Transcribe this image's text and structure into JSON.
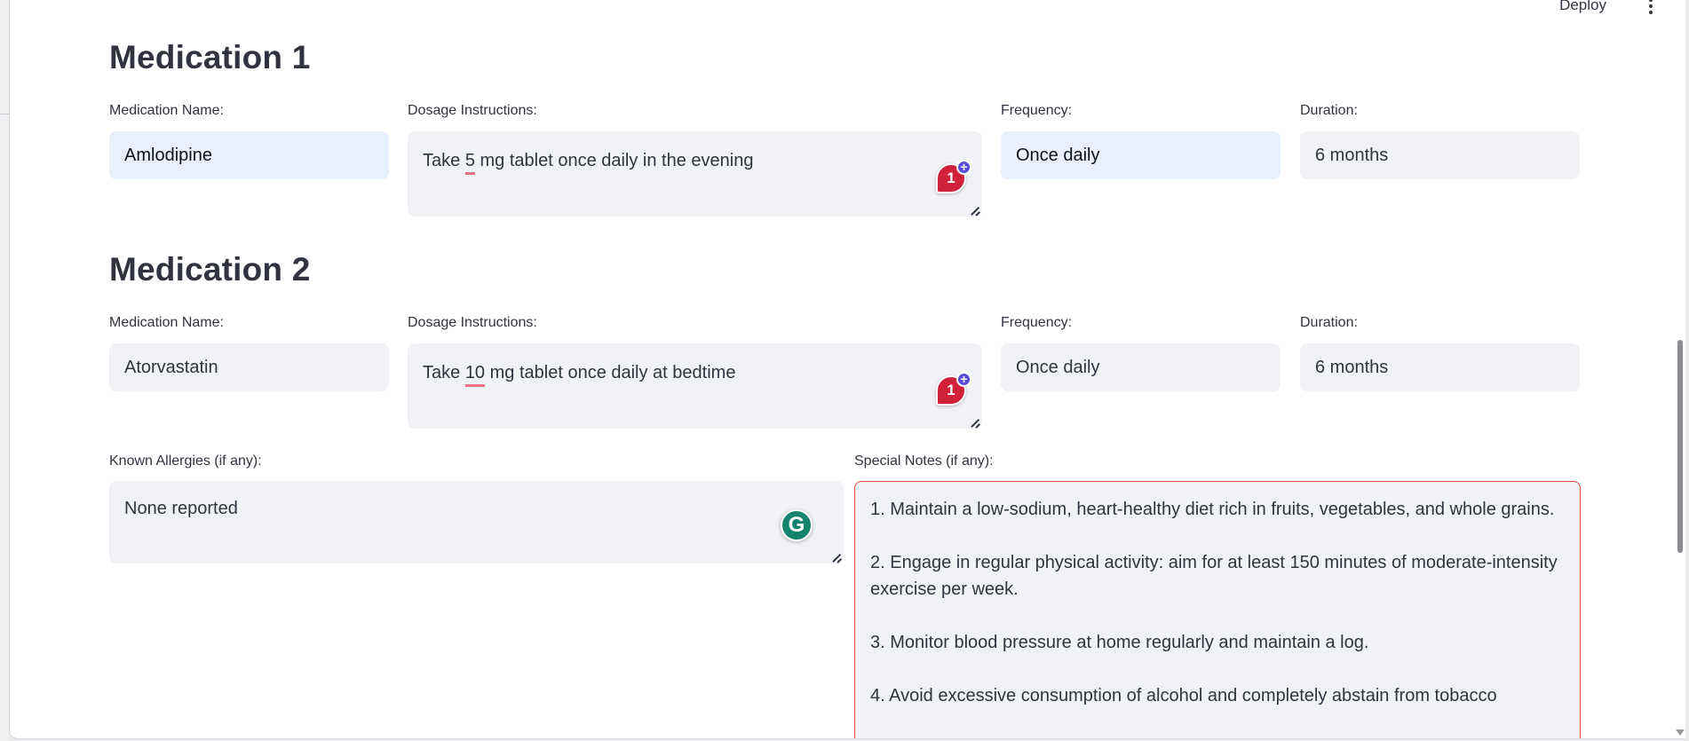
{
  "header": {
    "deploy_label": "Deploy",
    "menu_icon": "kebab-menu-icon"
  },
  "medications": [
    {
      "title": "Medication 1",
      "name_label": "Medication Name:",
      "name_value": "Amlodipine",
      "dosage_label": "Dosage Instructions:",
      "dosage_pre": "Take ",
      "dosage_underlined": "5",
      "dosage_post": " mg tablet once daily in the evening",
      "frequency_label": "Frequency:",
      "frequency_value": "Once daily",
      "duration_label": "Duration:",
      "duration_value": "6 months",
      "badge_count": "1"
    },
    {
      "title": "Medication 2",
      "name_label": "Medication Name:",
      "name_value": "Atorvastatin",
      "dosage_label": "Dosage Instructions:",
      "dosage_pre": "Take ",
      "dosage_underlined": "10",
      "dosage_post": " mg tablet once daily at bedtime",
      "frequency_label": "Frequency:",
      "frequency_value": "Once daily",
      "duration_label": "Duration:",
      "duration_value": "6 months",
      "badge_count": "1"
    }
  ],
  "allergies": {
    "label": "Known Allergies (if any):",
    "value": "None reported",
    "grammarly_glyph": "G"
  },
  "notes": {
    "label": "Special Notes (if any):",
    "items": [
      "1. Maintain a low-sodium, heart-healthy diet rich in fruits, vegetables, and whole grains.",
      "2. Engage in regular physical activity: aim for at least 150 minutes of moderate-intensity exercise per week.",
      "3. Monitor blood pressure at home regularly and maintain a log.",
      "4. Avoid excessive consumption of alcohol and completely abstain from tobacco"
    ]
  },
  "colors": {
    "accent_badge": "#d1203c",
    "badge_plus": "#5a4cdb",
    "grammarly": "#15846e",
    "notes_border": "#e8453c",
    "field_bg": "#f0f2f6",
    "field_selected_bg": "#e8f0fe"
  }
}
